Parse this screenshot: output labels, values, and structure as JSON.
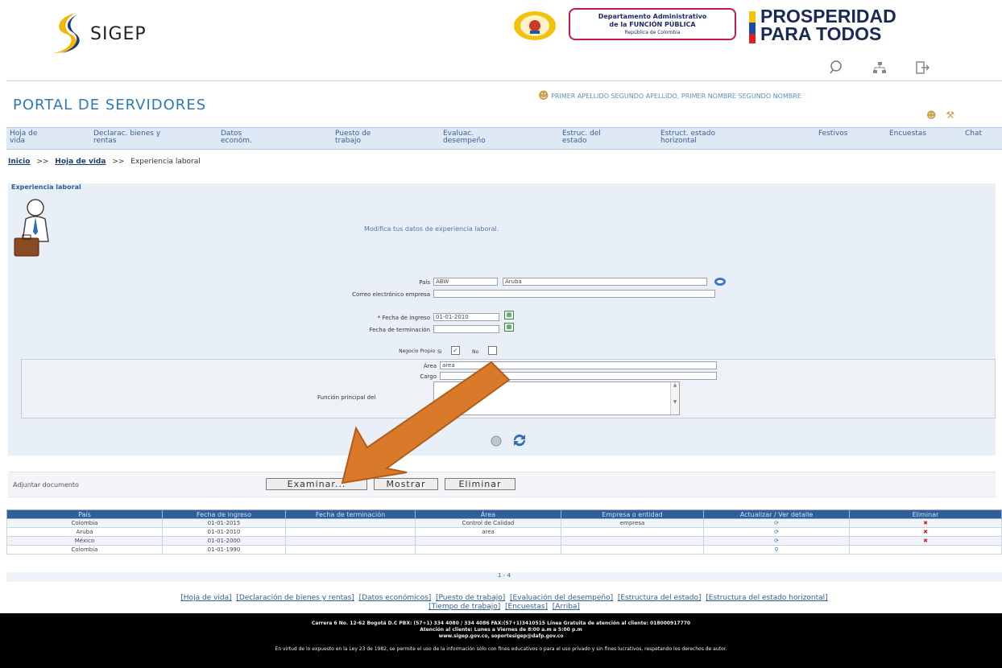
{
  "header": {
    "sigep_logo_text": "SIGEP",
    "dafp_line1": "Departamento Administrativo",
    "dafp_line2": "de la FUNCIÓN PÚBLICA",
    "dafp_line3": "República de Colombia",
    "prosperidad_line1": "PROSPERIDAD",
    "prosperidad_line2": "PARA TODOS",
    "icons": [
      "search-icon",
      "sitemap-icon",
      "logout-icon"
    ]
  },
  "portal": {
    "title": "PORTAL DE SERVIDORES",
    "user_name": "PRIMER APELLIDO SEGUNDO APELLIDO, PRIMER NOMBRE SEGUNDO NOMBRE"
  },
  "nav": {
    "items": [
      {
        "l1": "Hoja de",
        "l2": "vida"
      },
      {
        "l1": "Declarac. bienes y",
        "l2": "rentas"
      },
      {
        "l1": "Datos",
        "l2": "económ."
      },
      {
        "l1": "Puesto de",
        "l2": "trabajo"
      },
      {
        "l1": "Evaluac.",
        "l2": "desempeño"
      },
      {
        "l1": "Estruc. del",
        "l2": "estado"
      },
      {
        "l1": "Estruct. estado",
        "l2": "horizontal"
      },
      {
        "l1": "Festivos",
        "l2": ""
      },
      {
        "l1": "Encuestas",
        "l2": ""
      },
      {
        "l1": "Chat",
        "l2": ""
      }
    ]
  },
  "breadcrumb": {
    "home": "Inicio",
    "sep": ">>",
    "level1": "Hoja de vida",
    "current": "Experiencia laboral"
  },
  "section": {
    "title": "Experiencia laboral",
    "instruction": "Modifica tus datos de experiencia laboral."
  },
  "form": {
    "pais_label": "País",
    "pais_code": "ABW",
    "pais_name": "Aruba",
    "correo_label": "Correo electrónico empresa",
    "correo_value": "",
    "fecha_ingreso_label": "* Fecha de ingreso",
    "fecha_ingreso_value": "01-01-2010",
    "fecha_terminacion_label": "Fecha de terminación",
    "fecha_terminacion_value": "",
    "negocio_label": "Negocio Propio",
    "si_label": "Si",
    "no_label": "No",
    "si_checked": true,
    "area_label": "Área",
    "area_value": "area",
    "cargo_label": "Cargo",
    "cargo_value": "",
    "funcion_label": "Función principal del"
  },
  "attach": {
    "label": "Adjuntar documento",
    "examinar": "Examinar...",
    "mostrar": "Mostrar",
    "eliminar": "Eliminar"
  },
  "table": {
    "headers": [
      "País",
      "Fecha de ingreso",
      "Fecha de terminación",
      "Área",
      "Empresa o entidad",
      "Actualizar / Ver detalle",
      "Eliminar"
    ],
    "rows": [
      [
        "Colombia",
        "01-01-2015",
        "",
        "Control de Calidad",
        "empresa",
        "edit",
        "delete"
      ],
      [
        "Aruba",
        "01-01-2010",
        "",
        "area",
        "",
        "edit",
        "delete"
      ],
      [
        "México",
        "01-01-2000",
        "",
        "",
        "",
        "edit",
        "delete"
      ],
      [
        "Colombia",
        "01-01-1990",
        "",
        "",
        "",
        "view",
        ""
      ]
    ],
    "pager": "1 - 4"
  },
  "footer_links": {
    "line1": [
      "[Hoja de vida]",
      "[Declaración de bienes y rentas]",
      "[Datos económicos]",
      "[Puesto de trabajo]",
      "[Evaluación del desempeño]",
      "[Estructura del estado]",
      "[Estructura del estado horizontal]"
    ],
    "line2": [
      "[Tiempo de trabajo]",
      "[Encuestas]",
      "[Arriba]"
    ]
  },
  "footer": {
    "address": "Carrera 6 No. 12-62 Bogotá D.C PBX: (57+1) 334 4080 / 334 4086 FAX:(57+1)3410515 Línea Gratuita de atención al cliente: 018000917770",
    "hours": "Atención al cliente: Lunes a Viernes de 8:00 a.m a 5:00 p.m",
    "web": "www.sigep.gov.co, soportesigep@dafp.gov.co",
    "legal": "En virtud de lo expuesto en la Ley 23 de 1982, se permite el uso de la información sólo con fines educativos o para el uso privado y sin fines lucrativos, respetando los derechos de autor."
  },
  "colors": {
    "brand_blue": "#2f79b7",
    "header_blue": "#2f5f99",
    "annotation_arrow": "#d97a2b"
  }
}
